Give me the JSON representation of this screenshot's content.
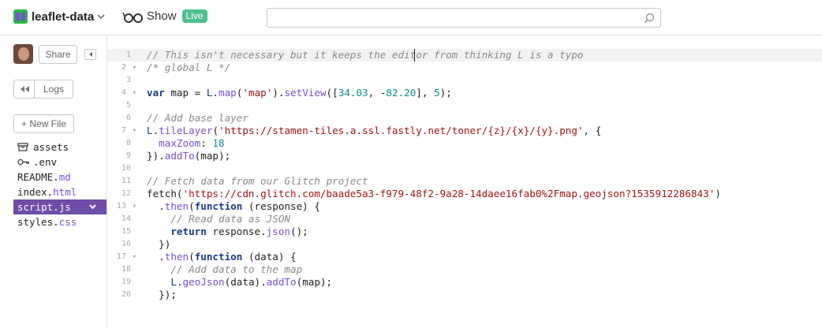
{
  "header": {
    "project_name": "leaflet-data",
    "show_label": "Show",
    "live_badge": "Live",
    "search_placeholder": ""
  },
  "sidebar": {
    "share_label": "Share",
    "logs_label": "Logs",
    "new_file_label": "+ New File",
    "files": [
      {
        "name": "assets",
        "ext": "",
        "icon": "box-icon",
        "selected": false
      },
      {
        "name": ".env",
        "ext": "",
        "icon": "key-icon",
        "selected": false
      },
      {
        "name": "README.",
        "ext": "md",
        "icon": "",
        "selected": false
      },
      {
        "name": "index.",
        "ext": "html",
        "icon": "",
        "selected": false
      },
      {
        "name": "script.",
        "ext": "js",
        "icon": "",
        "selected": true
      },
      {
        "name": "styles.",
        "ext": "css",
        "icon": "",
        "selected": false
      }
    ]
  },
  "editor": {
    "lines": [
      {
        "n": "1",
        "fold": false,
        "tokens": [
          [
            "c-comment",
            "// This isn't necessary but it keeps the editor from thinking L is a typo"
          ]
        ]
      },
      {
        "n": "2",
        "fold": true,
        "tokens": [
          [
            "c-comment",
            "/* global L */"
          ]
        ]
      },
      {
        "n": "3",
        "fold": false,
        "tokens": []
      },
      {
        "n": "4",
        "fold": true,
        "tokens": [
          [
            "c-kw",
            "var"
          ],
          [
            "c-plain",
            " map = "
          ],
          [
            "c-var",
            "L"
          ],
          [
            "c-plain",
            "."
          ],
          [
            "c-fn",
            "map"
          ],
          [
            "c-plain",
            "("
          ],
          [
            "c-str",
            "'map'"
          ],
          [
            "c-plain",
            ")."
          ],
          [
            "c-fn",
            "setView"
          ],
          [
            "c-plain",
            "(["
          ],
          [
            "c-num",
            "34.03"
          ],
          [
            "c-plain",
            ", -"
          ],
          [
            "c-num",
            "82.20"
          ],
          [
            "c-plain",
            "], "
          ],
          [
            "c-num",
            "5"
          ],
          [
            "c-plain",
            ");"
          ]
        ]
      },
      {
        "n": "5",
        "fold": false,
        "tokens": []
      },
      {
        "n": "6",
        "fold": false,
        "tokens": [
          [
            "c-comment",
            "// Add base layer"
          ]
        ]
      },
      {
        "n": "7",
        "fold": true,
        "tokens": [
          [
            "c-var",
            "L"
          ],
          [
            "c-plain",
            "."
          ],
          [
            "c-fn",
            "tileLayer"
          ],
          [
            "c-plain",
            "("
          ],
          [
            "c-str",
            "'https://stamen-tiles.a.ssl.fastly.net/toner/{z}/{x}/{y}.png'"
          ],
          [
            "c-plain",
            ", {"
          ]
        ]
      },
      {
        "n": "8",
        "fold": false,
        "tokens": [
          [
            "c-plain",
            "  "
          ],
          [
            "c-prop",
            "maxZoom"
          ],
          [
            "c-plain",
            ": "
          ],
          [
            "c-num",
            "18"
          ]
        ]
      },
      {
        "n": "9",
        "fold": false,
        "tokens": [
          [
            "c-plain",
            "})."
          ],
          [
            "c-fn",
            "addTo"
          ],
          [
            "c-plain",
            "(map);"
          ]
        ]
      },
      {
        "n": "10",
        "fold": false,
        "tokens": []
      },
      {
        "n": "11",
        "fold": false,
        "tokens": [
          [
            "c-comment",
            "// Fetch data from our Glitch project"
          ]
        ]
      },
      {
        "n": "12",
        "fold": false,
        "tokens": [
          [
            "c-plain",
            "fetch("
          ],
          [
            "c-str",
            "'https://cdn.glitch.com/baade5a3-f979-48f2-9a28-14daee16fab0%2Fmap.geojson?1535912286843'"
          ],
          [
            "c-plain",
            ")"
          ]
        ]
      },
      {
        "n": "13",
        "fold": true,
        "tokens": [
          [
            "c-plain",
            "  ."
          ],
          [
            "c-fn",
            "then"
          ],
          [
            "c-plain",
            "("
          ],
          [
            "c-kw",
            "function"
          ],
          [
            "c-plain",
            " (response) {"
          ]
        ]
      },
      {
        "n": "14",
        "fold": false,
        "tokens": [
          [
            "c-plain",
            "    "
          ],
          [
            "c-comment",
            "// Read data as JSON"
          ]
        ]
      },
      {
        "n": "15",
        "fold": false,
        "tokens": [
          [
            "c-plain",
            "    "
          ],
          [
            "c-kw",
            "return"
          ],
          [
            "c-plain",
            " response."
          ],
          [
            "c-fn",
            "json"
          ],
          [
            "c-plain",
            "();"
          ]
        ]
      },
      {
        "n": "16",
        "fold": false,
        "tokens": [
          [
            "c-plain",
            "  })"
          ]
        ]
      },
      {
        "n": "17",
        "fold": true,
        "tokens": [
          [
            "c-plain",
            "  ."
          ],
          [
            "c-fn",
            "then"
          ],
          [
            "c-plain",
            "("
          ],
          [
            "c-kw",
            "function"
          ],
          [
            "c-plain",
            " (data) {"
          ]
        ]
      },
      {
        "n": "18",
        "fold": false,
        "tokens": [
          [
            "c-plain",
            "    "
          ],
          [
            "c-comment",
            "// Add data to the map"
          ]
        ]
      },
      {
        "n": "19",
        "fold": false,
        "tokens": [
          [
            "c-plain",
            "    "
          ],
          [
            "c-var",
            "L"
          ],
          [
            "c-plain",
            "."
          ],
          [
            "c-fn",
            "geoJson"
          ],
          [
            "c-plain",
            "(data)."
          ],
          [
            "c-fn",
            "addTo"
          ],
          [
            "c-plain",
            "(map);"
          ]
        ]
      },
      {
        "n": "20",
        "fold": false,
        "tokens": [
          [
            "c-plain",
            "  });"
          ]
        ]
      }
    ]
  }
}
